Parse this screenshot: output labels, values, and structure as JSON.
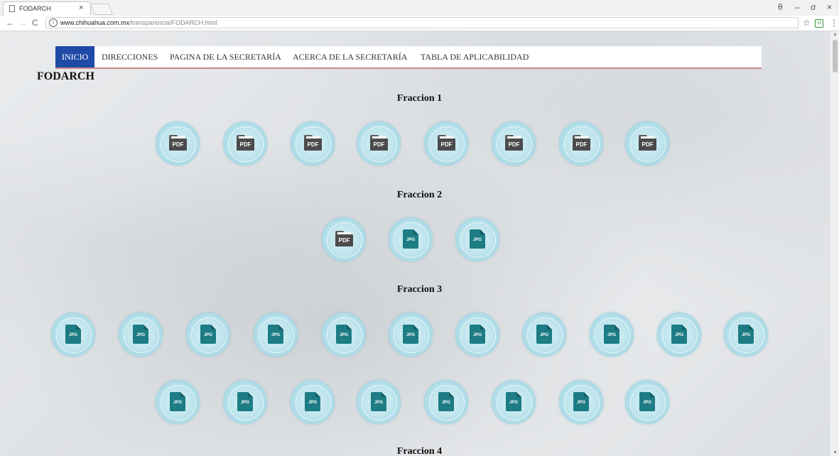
{
  "browser": {
    "tab_title": "FODARCH",
    "tab_close": "×",
    "url_domain": "www.chihuahua.com.mx",
    "url_path": "/transparencia/FODARCH.html",
    "back": "←",
    "forward": "→",
    "reload": "C",
    "info": "i",
    "star": "☆",
    "ext": "U",
    "menu": "⋮",
    "account": "θ",
    "minimize": "–",
    "maximize": "σ",
    "close": "×"
  },
  "nav": {
    "items": [
      {
        "label": "INICIO",
        "active": true
      },
      {
        "label": "DIRECCIONES"
      },
      {
        "label": "PAGINA DE LA SECRETARÍA"
      },
      {
        "label": "ACERCA DE LA SECRETARÍA"
      },
      {
        "label": "TABLA DE APLICABILIDAD"
      }
    ]
  },
  "page": {
    "title": "FODARCH",
    "sections": [
      {
        "title": "Fraccion 1"
      },
      {
        "title": "Fraccion 2"
      },
      {
        "title": "Fraccion 3"
      },
      {
        "title": "Fraccion 4"
      }
    ]
  },
  "icons": {
    "pdf_label": "PDF",
    "jpg_label": "JPG"
  },
  "colors": {
    "nav_active": "#1f4aa6",
    "jpg_icon": "#1d7c84",
    "pdf_icon": "#4b4b4b"
  }
}
